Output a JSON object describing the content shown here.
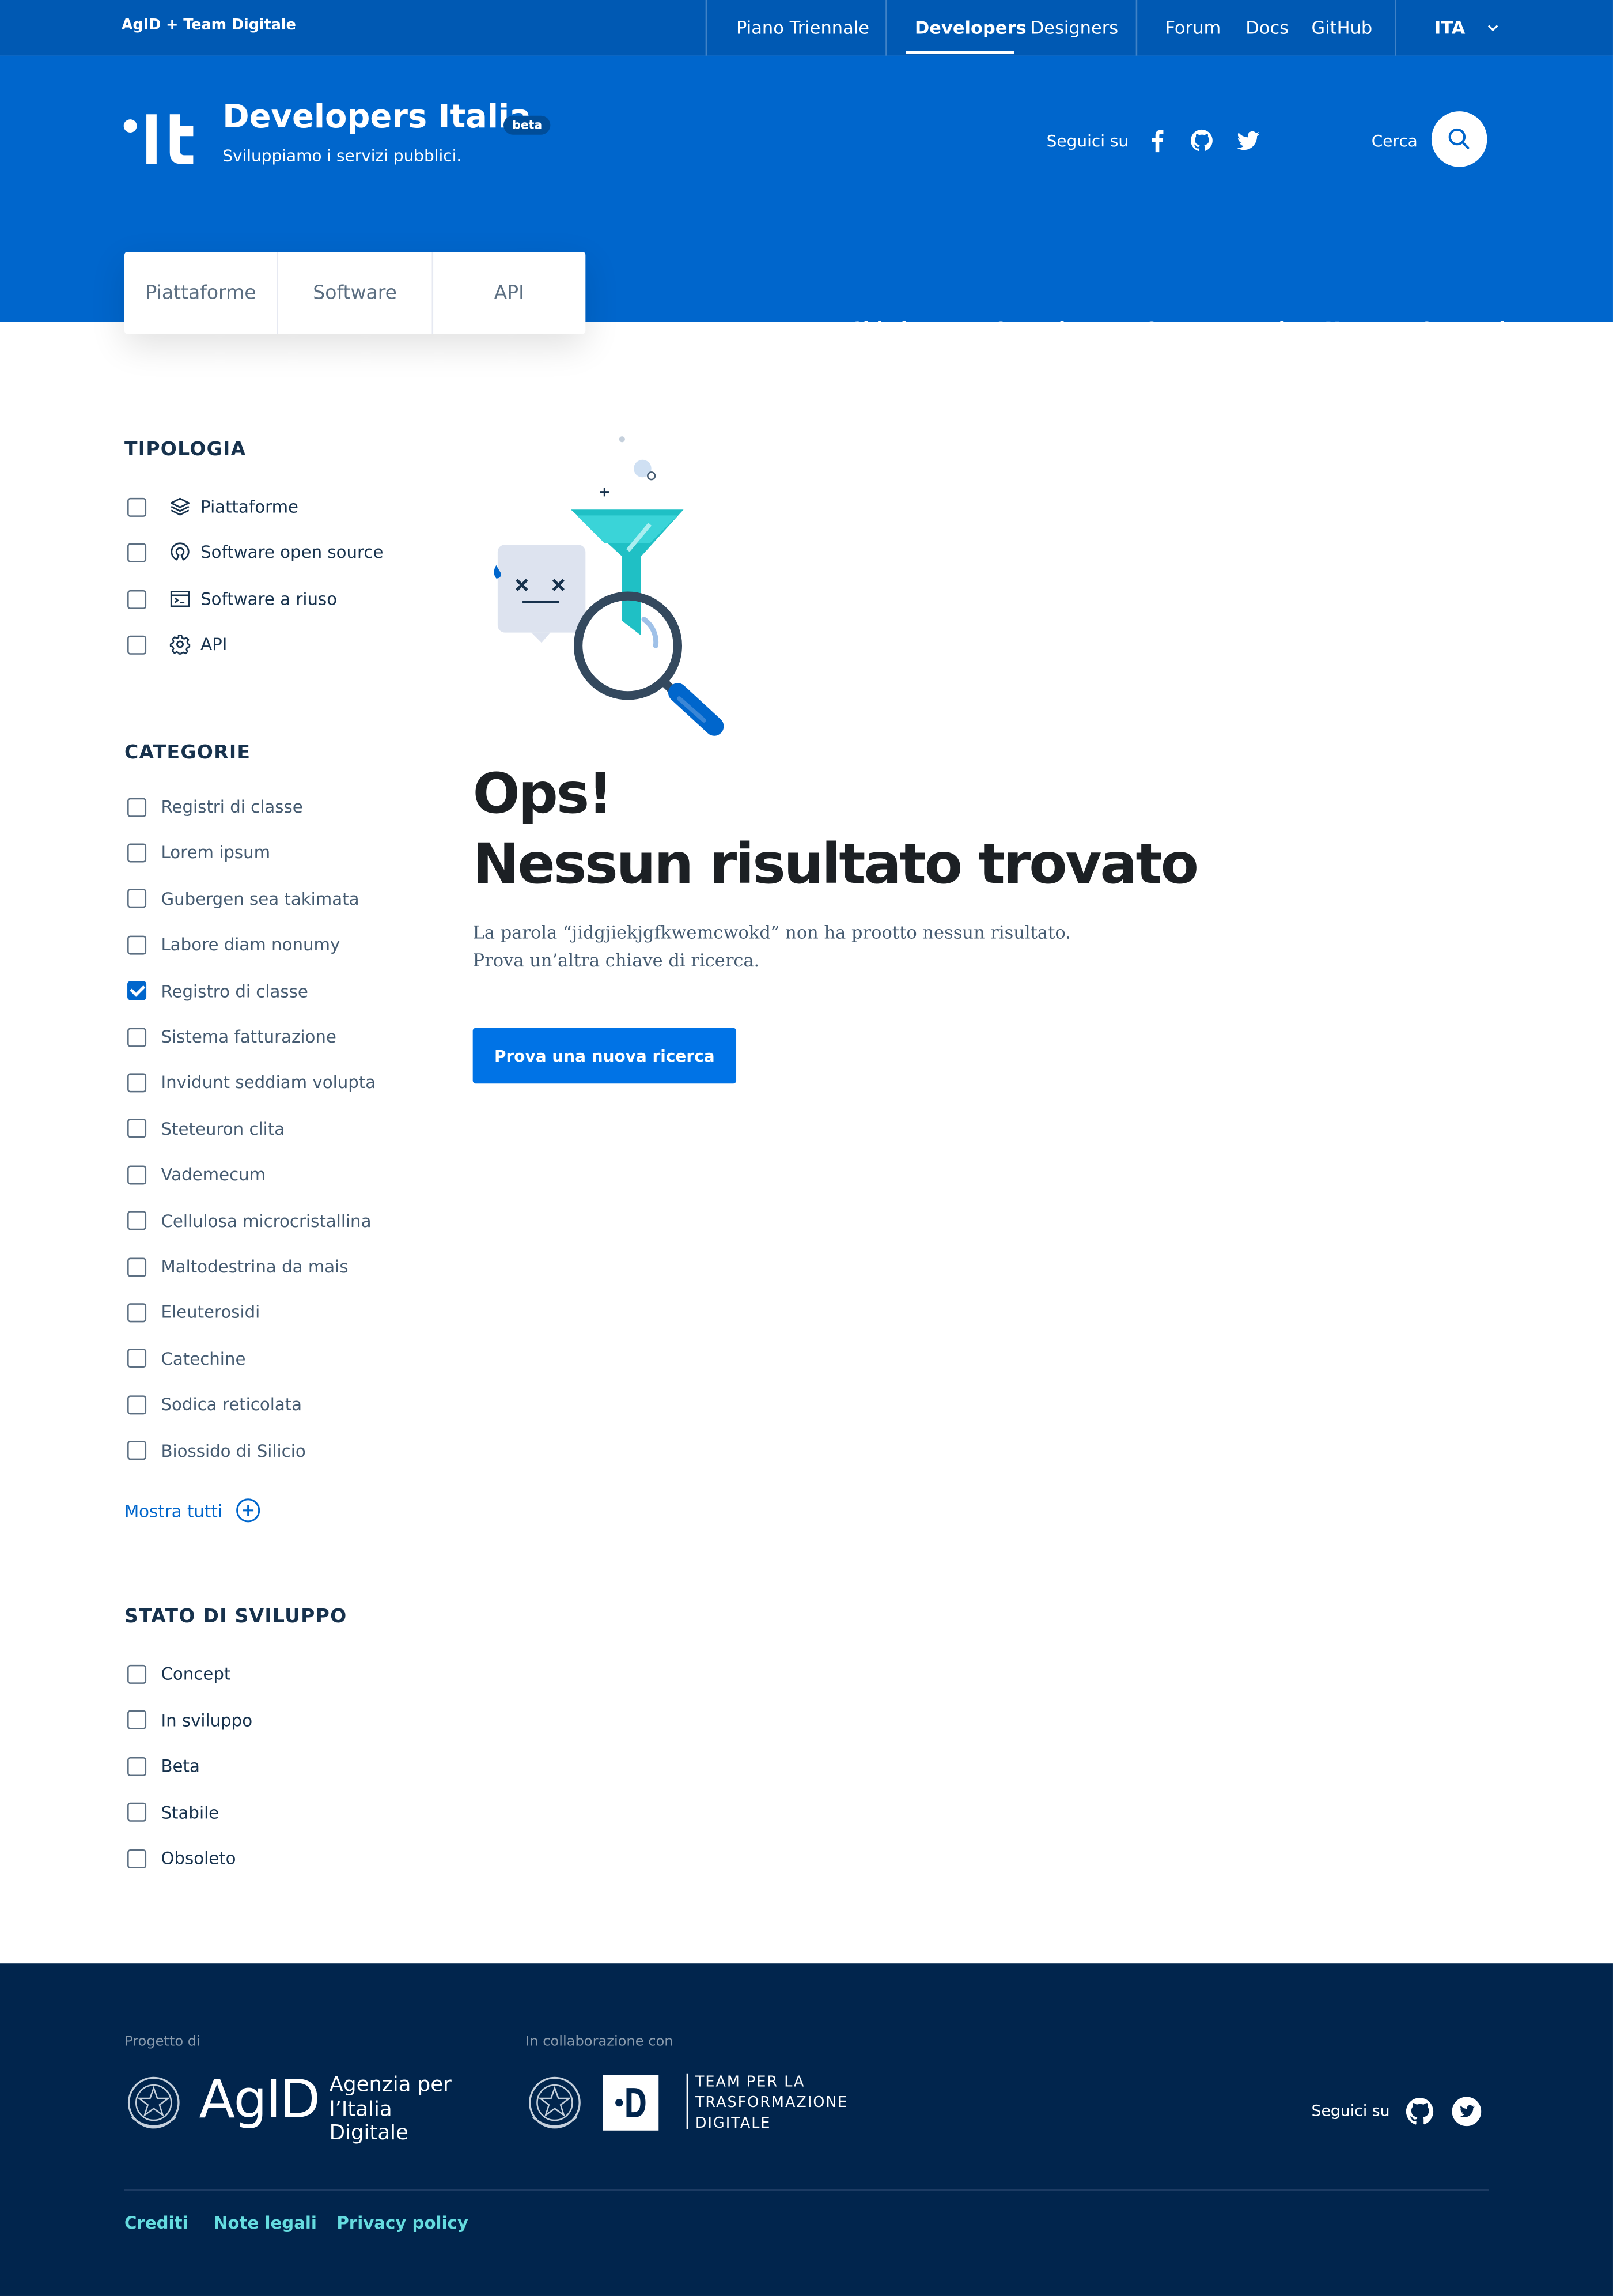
{
  "slimbar": {
    "brand": "AgID  +  Team Digitale",
    "links": [
      "Piano Triennale",
      "Developers",
      "Designers",
      "Forum",
      "Docs",
      "GitHub"
    ],
    "language": "ITA"
  },
  "header": {
    "title": "Developers Italia",
    "badge": "beta",
    "tagline": "Sviluppiamo i servizi pubblici.",
    "follow_label": "Seguici su",
    "search_label": "Cerca"
  },
  "tabs": [
    "Piattaforme",
    "Software",
    "API"
  ],
  "mainnav": [
    "Chi siamo",
    "Come lo uso",
    "Come partecipo",
    "News",
    "Contatti"
  ],
  "filters": {
    "tipologia": {
      "title": "TIPOLOGIA",
      "items": [
        {
          "label": "Piattaforme",
          "icon": "layers-icon"
        },
        {
          "label": "Software open source",
          "icon": "open-source-icon"
        },
        {
          "label": "Software a riuso",
          "icon": "terminal-icon"
        },
        {
          "label": "API",
          "icon": "gear-icon"
        }
      ]
    },
    "categorie": {
      "title": "CATEGORIE",
      "items": [
        {
          "label": "Registri di classe",
          "checked": false
        },
        {
          "label": "Lorem ipsum",
          "checked": false
        },
        {
          "label": "Gubergen sea takimata",
          "checked": false
        },
        {
          "label": "Labore diam nonumy",
          "checked": false
        },
        {
          "label": "Registro di classe",
          "checked": true
        },
        {
          "label": "Sistema fatturazione",
          "checked": false
        },
        {
          "label": "Invidunt seddiam volupta",
          "checked": false
        },
        {
          "label": "Steteuron clita",
          "checked": false
        },
        {
          "label": "Vademecum",
          "checked": false
        },
        {
          "label": "Cellulosa microcristallina",
          "checked": false
        },
        {
          "label": "Maltodestrina da mais",
          "checked": false
        },
        {
          "label": "Eleuterosidi",
          "checked": false
        },
        {
          "label": "Catechine",
          "checked": false
        },
        {
          "label": "Sodica reticolata",
          "checked": false
        },
        {
          "label": "Biossido di Silicio",
          "checked": false
        }
      ],
      "show_all": "Mostra tutti"
    },
    "stato": {
      "title": "STATO DI SVILUPPO",
      "items": [
        "Concept",
        "In sviluppo",
        "Beta",
        "Stabile",
        "Obsoleto"
      ]
    }
  },
  "result": {
    "line1": "Ops!",
    "line2": "Nessun risultato trovato",
    "desc1": "La parola “jidgjiekjgfkwemcwokd” non ha prootto nessun risultato.",
    "desc2": "Prova un’altra chiave di ricerca.",
    "button": "Prova una nuova ricerca"
  },
  "footer": {
    "project_label": "Progetto di",
    "agid_short": "AgID",
    "agid_line1": "Agenzia per",
    "agid_line2": "l’Italia Digitale",
    "collab_label": "In collaborazione con",
    "team_line1": "TEAM PER LA",
    "team_line2": "TRASFORMAZIONE",
    "team_line3": "DIGITALE",
    "follow_label": "Seguici su",
    "links": [
      "Crediti",
      "Note legali",
      "Privacy policy"
    ]
  },
  "colors": {
    "primary": "#0066cc",
    "dark": "#01254d",
    "accent": "#65dcdf"
  }
}
